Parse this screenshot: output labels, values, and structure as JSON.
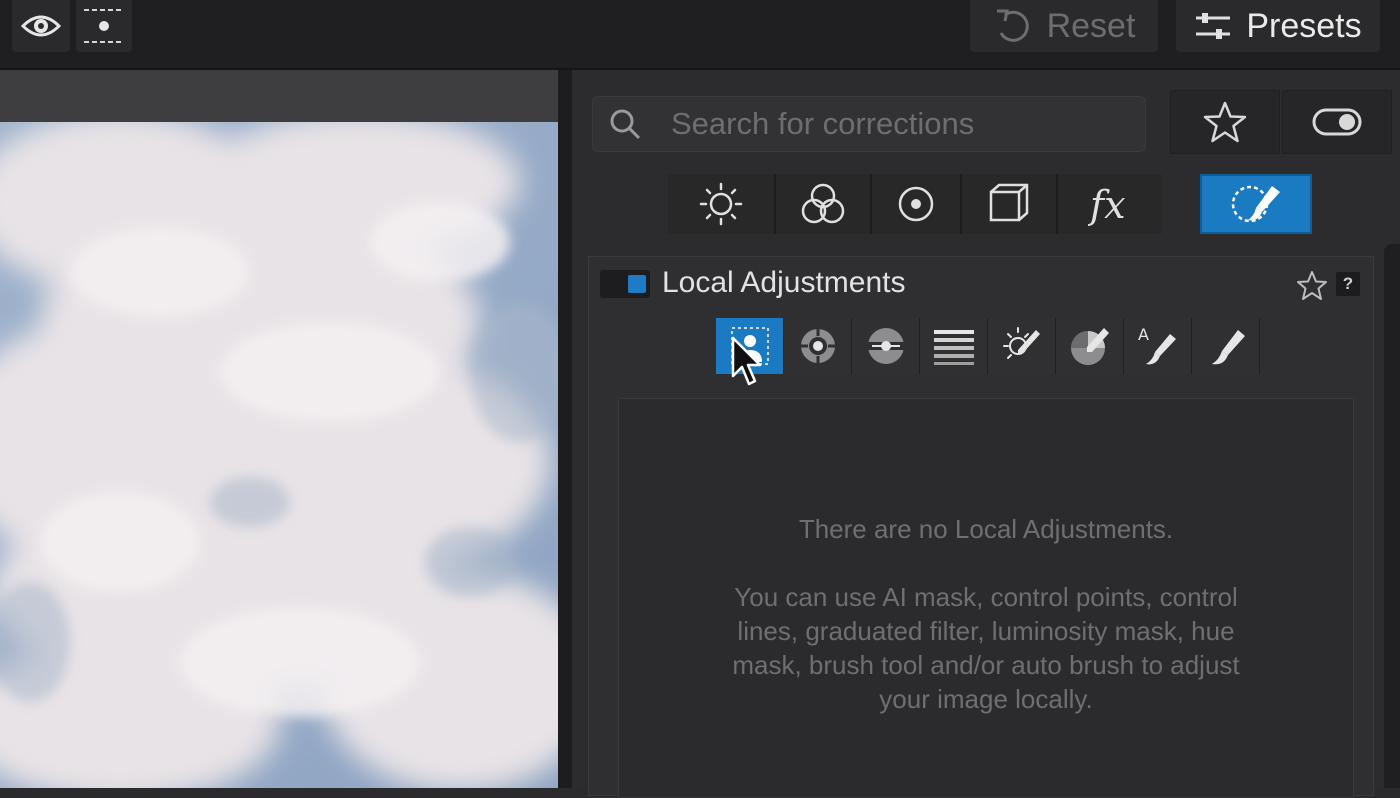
{
  "toolbar": {
    "reset_label": "Reset",
    "presets_label": "Presets"
  },
  "search": {
    "placeholder": "Search for corrections"
  },
  "palette_tabs": [
    "light-icon",
    "color-icon",
    "detail-icon",
    "geometry-icon",
    "effects-icon"
  ],
  "active_tab": "local-adjustments",
  "local_adjustments": {
    "title": "Local Adjustments",
    "help_label": "?",
    "tools": [
      "ai-mask",
      "control-point",
      "control-line",
      "graduated-filter",
      "luminosity-mask",
      "hue-mask",
      "auto-brush",
      "brush"
    ],
    "active_tool": "ai-mask",
    "auto_brush_letter": "A",
    "empty_message_1": "There are no Local Adjustments.",
    "empty_message_2": "You can use AI mask, control points, control lines, graduated filter, luminosity mask, hue mask, brush tool and/or auto brush to adjust your image locally."
  },
  "colors": {
    "accent": "#1a7ac2",
    "background": "#2b2b2d",
    "topbar": "#1f1f21"
  }
}
